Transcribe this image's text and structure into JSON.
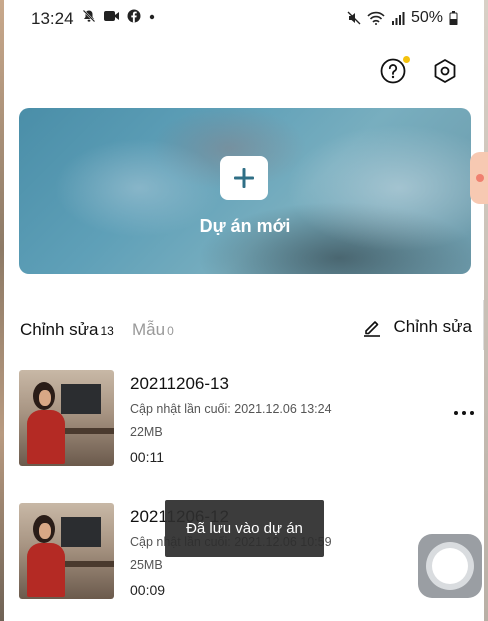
{
  "status_bar": {
    "time": "13:24",
    "battery": "50%"
  },
  "header": {
    "help_icon": "question-circle-icon",
    "settings_icon": "hexagon-settings-icon",
    "notification_dot_color": "#f4c20d"
  },
  "new_project": {
    "label": "Dự án mới",
    "icon": "plus-icon"
  },
  "tabs": {
    "edit_label": "Chỉnh sửa",
    "edit_count": "13",
    "templates_label": "Mẫu",
    "templates_count": "0",
    "edit_action_label": "Chỉnh sửa"
  },
  "projects": [
    {
      "title": "20211206-13",
      "updated": "Cập nhật lần cuối: 2021.12.06 13:24",
      "size": "22MB",
      "duration": "00:11"
    },
    {
      "title": "20211206-12",
      "updated": "Cập nhật lần cuối: 2021.12.06 10:59",
      "size": "25MB",
      "duration": "00:09"
    }
  ],
  "toast": {
    "message": "Đã lưu vào dự án"
  }
}
